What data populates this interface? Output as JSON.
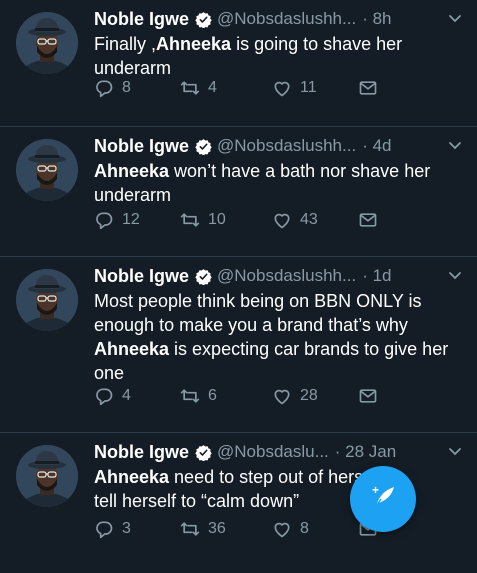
{
  "tweets": [
    {
      "name": "Noble Igwe",
      "handle": "@Nobsdaslushh...",
      "time": "· 8h",
      "text_parts": [
        {
          "t": "Finally ,",
          "b": false
        },
        {
          "t": "Ahneeka",
          "b": true
        },
        {
          "t": " is going to shave her underarm",
          "b": false
        }
      ],
      "replies": "8",
      "retweets": "4",
      "likes": "11"
    },
    {
      "name": "Noble Igwe",
      "handle": "@Nobsdaslushh...",
      "time": "· 4d",
      "text_parts": [
        {
          "t": "Ahneeka",
          "b": true
        },
        {
          "t": " won’t have a bath nor shave her underarm",
          "b": false
        }
      ],
      "replies": "12",
      "retweets": "10",
      "likes": "43"
    },
    {
      "name": "Noble Igwe",
      "handle": "@Nobsdaslushh...",
      "time": "· 1d",
      "text_parts": [
        {
          "t": "Most people think being on BBN ONLY  is enough to make you a brand that’s why ",
          "b": false
        },
        {
          "t": "Ahneeka",
          "b": true
        },
        {
          "t": " is expecting car brands to give her one",
          "b": false
        }
      ],
      "replies": "4",
      "retweets": "6",
      "likes": "28"
    },
    {
      "name": "Noble Igwe",
      "handle": "@Nobsdaslu...",
      "time": "· 28 Jan",
      "text_parts": [
        {
          "t": "Ahneeka",
          "b": true
        },
        {
          "t": " need to step out of hers",
          "b": false
        },
        {
          "t": "\n",
          "b": false
        },
        {
          "t": "tell herself to “calm down”",
          "b": false
        }
      ],
      "replies": "3",
      "retweets": "36",
      "likes": "8"
    }
  ],
  "colors": {
    "background": "#141d26",
    "secondary_text": "#8899a6",
    "accent": "#1da1f2"
  },
  "icons": {
    "verified": "verified-badge-icon",
    "chevron": "chevron-down-icon",
    "reply": "reply-icon",
    "retweet": "retweet-icon",
    "like": "heart-icon",
    "dm": "envelope-icon",
    "compose": "compose-tweet-icon"
  }
}
